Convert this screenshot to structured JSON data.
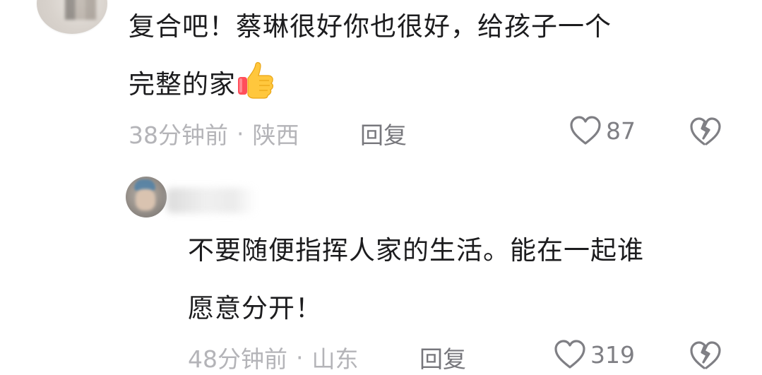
{
  "comments": [
    {
      "text_line1": "复合吧！蔡琳很好你也很好，给孩子一个",
      "text_line2": "完整的家",
      "emoji": "thumbs-up-icon",
      "time": "38分钟前",
      "separator": "·",
      "location": "陕西",
      "reply_label": "回复",
      "likes": "87"
    },
    {
      "text_line1": "不要随便指挥人家的生活。能在一起谁",
      "text_line2": "愿意分开！",
      "time": "48分钟前",
      "separator": "·",
      "location": "山东",
      "reply_label": "回复",
      "likes": "319"
    }
  ],
  "colors": {
    "text": "#1c1c1e",
    "meta": "#b4b4b8",
    "action": "#77777c"
  }
}
